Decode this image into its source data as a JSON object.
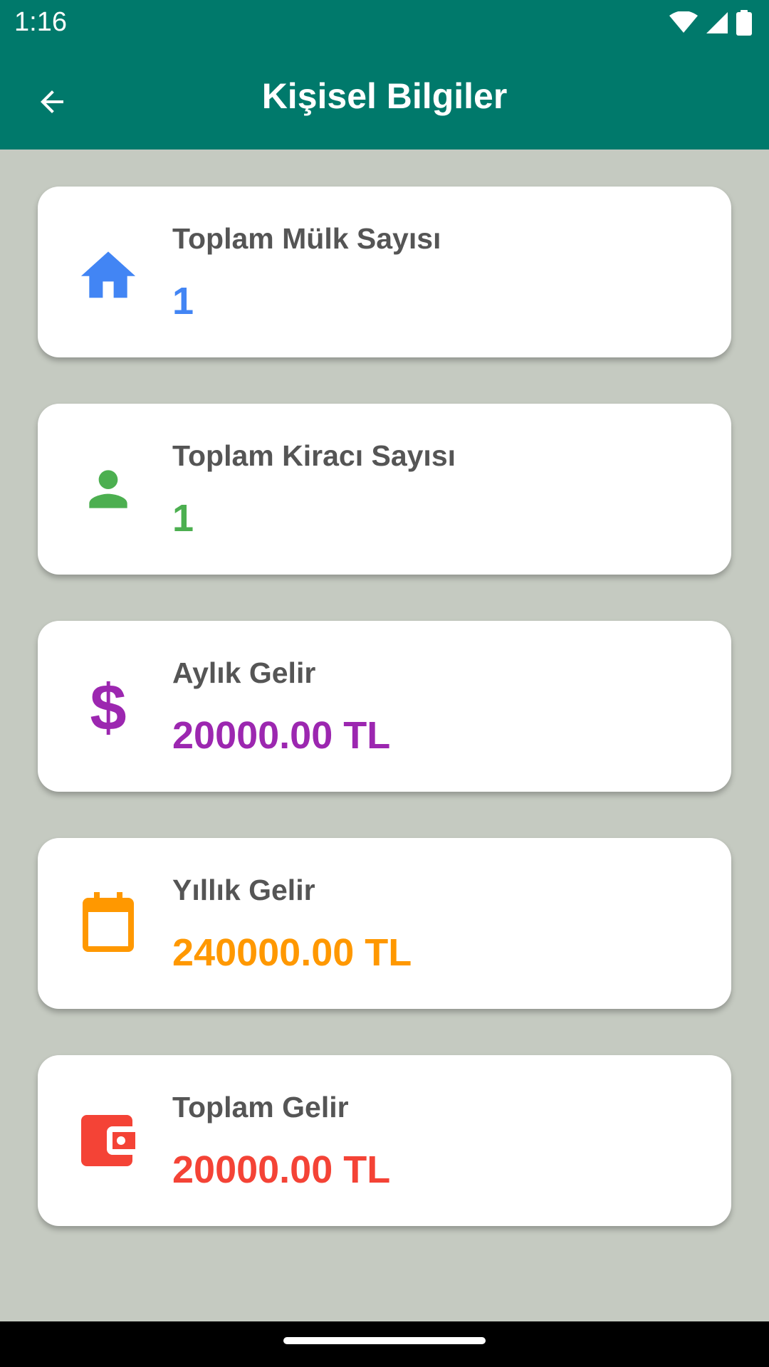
{
  "status_bar": {
    "time": "1:16"
  },
  "app_bar": {
    "title": "Kişisel Bilgiler"
  },
  "cards": [
    {
      "label": "Toplam Mülk Sayısı",
      "value": "1",
      "icon": "home-icon",
      "color": "#4285f4"
    },
    {
      "label": "Toplam Kiracı Sayısı",
      "value": "1",
      "icon": "person-icon",
      "color": "#4caf50"
    },
    {
      "label": "Aylık Gelir",
      "value": "20000.00 TL",
      "icon": "dollar-icon",
      "color": "#9c27b0"
    },
    {
      "label": "Yıllık Gelir",
      "value": "240000.00 TL",
      "icon": "calendar-icon",
      "color": "#ff9800"
    },
    {
      "label": "Toplam Gelir",
      "value": "20000.00 TL",
      "icon": "wallet-icon",
      "color": "#f44336"
    }
  ]
}
